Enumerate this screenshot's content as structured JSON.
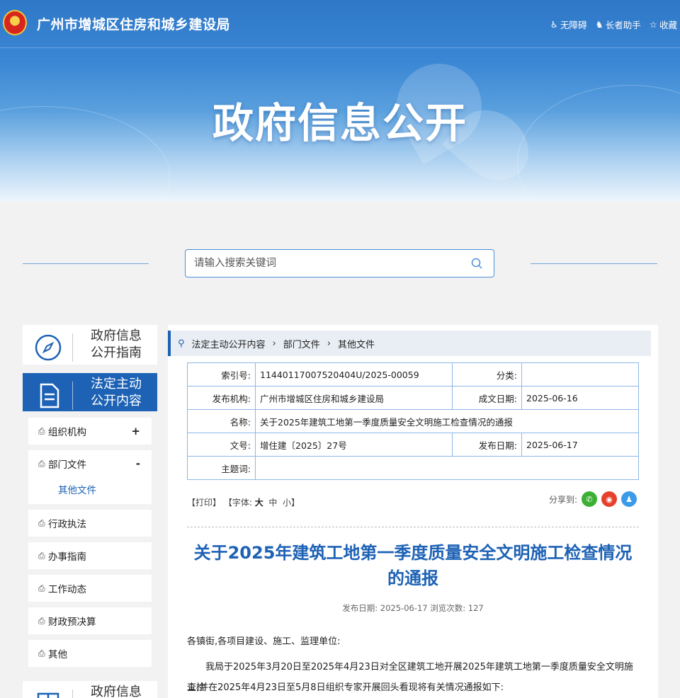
{
  "header": {
    "site_title": "广州市增城区住房和城乡建设局",
    "links": [
      {
        "icon": "wheelchair-icon",
        "label": "无障碍"
      },
      {
        "icon": "elder-icon",
        "label": "长者助手"
      },
      {
        "icon": "star-icon",
        "label": "收藏"
      }
    ],
    "banner_title": "政府信息公开"
  },
  "search": {
    "placeholder": "请输入搜索关键词"
  },
  "sidebar": {
    "guide_label": "政府信息公开指南",
    "guide_line1": "政府信息",
    "guide_line2": "公开指南",
    "active_line1": "法定主动",
    "active_line2": "公开内容",
    "bottom_line1": "政府信息",
    "items": [
      {
        "label": "组织机构",
        "toggle": "+"
      },
      {
        "label": "部门文件",
        "toggle": "-"
      },
      {
        "label": "其他文件"
      },
      {
        "label": "行政执法"
      },
      {
        "label": "办事指南"
      },
      {
        "label": "工作动态"
      },
      {
        "label": "财政预决算"
      },
      {
        "label": "其他"
      }
    ]
  },
  "breadcrumb": [
    "法定主动公开内容",
    "部门文件",
    "其他文件"
  ],
  "meta": {
    "index_label": "索引号:",
    "index_value": "11440117007520404U/2025-00059",
    "category_label": "分类:",
    "category_value": "",
    "publisher_label": "发布机构:",
    "publisher_value": "广州市增城区住房和城乡建设局",
    "date_made_label": "成文日期:",
    "date_made_value": "2025-06-16",
    "name_label": "名称:",
    "name_value": "关于2025年建筑工地第一季度质量安全文明施工检查情况的通报",
    "docno_label": "文号:",
    "docno_value": "增住建〔2025〕27号",
    "pubdate_label": "发布日期:",
    "pubdate_value": "2025-06-17",
    "keywords_label": "主题词:",
    "keywords_value": ""
  },
  "tools": {
    "print": "【打印】",
    "font_prefix": "【字体:",
    "font_large": "大",
    "font_medium": "中",
    "font_small": "小",
    "font_suffix": "】",
    "share_label": "分享到:"
  },
  "share_icons": [
    "wechat-icon",
    "weibo-icon",
    "qq-icon"
  ],
  "colors": {
    "accent": "#1d62b5",
    "wechat": "#3cb035",
    "weibo": "#e6412c",
    "qq": "#3c9be8"
  },
  "article": {
    "title": "关于2025年建筑工地第一季度质量安全文明施工检查情况的通报",
    "pub_info": "发布日期: 2025-06-17  浏览次数: 127",
    "salutation": "各镇街,各项目建设、施工、监理单位:",
    "para1_line1": "我局于2025年3月20日至2025年4月23日对全区建筑工地开展2025年建筑工地第一季度质量安全文明施工检",
    "para1_line2": "查,并在2025年4月23日至5月8日组织专家开展回头看现将有关情况通报如下:"
  }
}
